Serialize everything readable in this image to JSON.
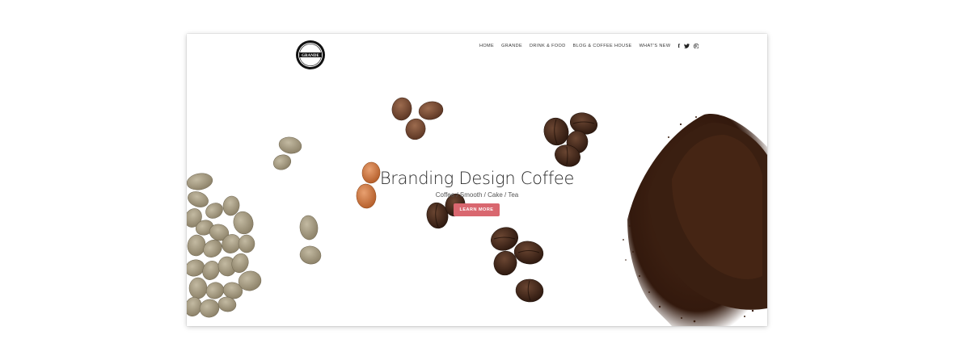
{
  "logo": {
    "text": "GRANDE"
  },
  "nav": {
    "items": [
      {
        "label": "HOME"
      },
      {
        "label": "GRANDE"
      },
      {
        "label": "DRINK & FOOD"
      },
      {
        "label": "BLOG & COFFEE HOUSE"
      },
      {
        "label": "WHAT'S NEW"
      }
    ],
    "social": [
      {
        "icon": "facebook-icon",
        "glyph": "f"
      },
      {
        "icon": "twitter-icon",
        "glyph": "t"
      },
      {
        "icon": "pinterest-icon",
        "glyph": "p"
      }
    ]
  },
  "hero": {
    "title": "Branding Design Coffee",
    "subtitle": "Coffee / Smooth / Cake / Tea",
    "cta_label": "LEARN MORE"
  },
  "colors": {
    "accent": "#d9676f",
    "green_bean": "#a59a80",
    "roasted_bean": "#3d2618",
    "light_roast": "#c9703a",
    "ground_coffee": "#3a2214"
  }
}
